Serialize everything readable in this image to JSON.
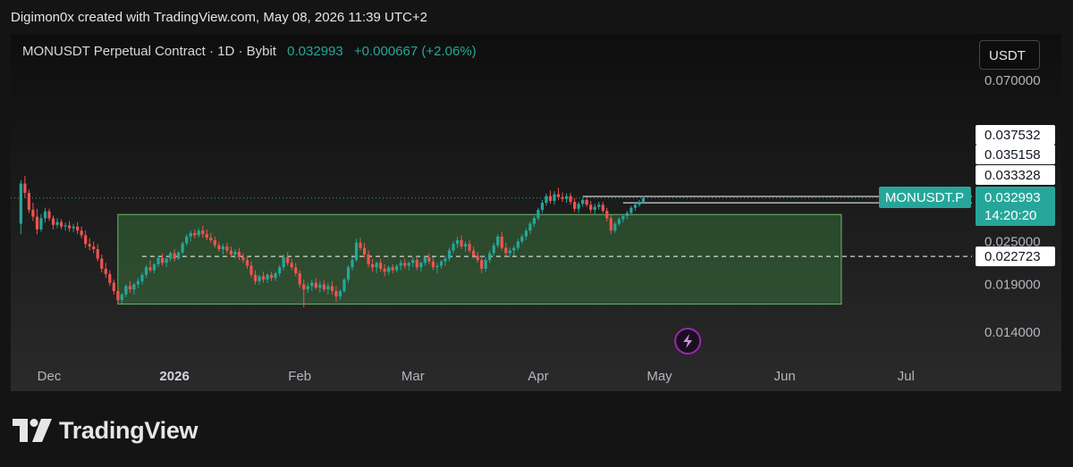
{
  "header": {
    "text": "Digimon0x created with TradingView.com, May 08, 2026 11:39 UTC+2"
  },
  "legend": {
    "title": "MONUSDT Perpetual Contract · 1D · Bybit",
    "price": "0.032993",
    "change": "+0.000667 (+2.06%)"
  },
  "currency_button": "USDT",
  "footer": {
    "brand": "TradingView"
  },
  "colors": {
    "up": "#26a69a",
    "down": "#ef5350",
    "box_fill": "rgba(76,175,80,0.30)",
    "box_stroke": "#66bb6a",
    "line": "#ffffff",
    "accent_icon": "#9c27b0"
  },
  "icons": {
    "logo": "tradingview-logo-icon",
    "lightning": "lightning-icon"
  },
  "chart_data": {
    "type": "candlestick",
    "title": "MONUSDT Perpetual Contract · 1D · Bybit",
    "x_axis_labels": [
      {
        "label": "Dec",
        "date": "2025-12-01",
        "bold": false
      },
      {
        "label": "2026",
        "date": "2026-01-01",
        "bold": true
      },
      {
        "label": "Feb",
        "date": "2026-02-01",
        "bold": false
      },
      {
        "label": "Mar",
        "date": "2026-03-01",
        "bold": false
      },
      {
        "label": "Apr",
        "date": "2026-04-01",
        "bold": false
      },
      {
        "label": "May",
        "date": "2026-05-01",
        "bold": false
      },
      {
        "label": "Jun",
        "date": "2026-06-01",
        "bold": false
      },
      {
        "label": "Jul",
        "date": "2026-07-01",
        "bold": false
      }
    ],
    "y_axis_labels": [
      "0.070000",
      "0.025000",
      "0.019000",
      "0.014000"
    ],
    "y_axis_values": [
      0.07,
      0.025,
      0.019,
      0.014
    ],
    "scale": "log",
    "current_price": {
      "symbol_label": "MONUSDT.P",
      "value": "0.032993",
      "countdown": "14:20:20"
    },
    "level_labels": [
      {
        "value": "0.037532",
        "style": "none"
      },
      {
        "value": "0.035158",
        "style": "none"
      },
      {
        "value": "0.033328",
        "style": "solid",
        "start_date": "2026-04-12"
      },
      {
        "value": "0.022723",
        "style": "dashed",
        "start_date": "2025-12-24"
      }
    ],
    "extra_line": {
      "value": 0.032,
      "start_date": "2026-04-22"
    },
    "range_box": {
      "start_date": "2025-12-18",
      "end_date": "2026-06-15",
      "top": 0.0297,
      "bottom": 0.01675
    },
    "lightning_marker_date": "2026-05-08",
    "ohlc_daily_from": "2025-11-24",
    "ohlc": [
      [
        0.028,
        0.037,
        0.0262,
        0.0362
      ],
      [
        0.0362,
        0.038,
        0.033,
        0.0341
      ],
      [
        0.0341,
        0.0348,
        0.03,
        0.0306
      ],
      [
        0.0306,
        0.032,
        0.0285,
        0.0293
      ],
      [
        0.0293,
        0.0308,
        0.0262,
        0.027
      ],
      [
        0.027,
        0.0298,
        0.0266,
        0.029
      ],
      [
        0.029,
        0.031,
        0.0282,
        0.0303
      ],
      [
        0.0303,
        0.0308,
        0.0285,
        0.029
      ],
      [
        0.029,
        0.0295,
        0.027,
        0.0278
      ],
      [
        0.0278,
        0.029,
        0.0272,
        0.0283
      ],
      [
        0.0283,
        0.0288,
        0.027,
        0.0275
      ],
      [
        0.0275,
        0.0282,
        0.0268,
        0.0277
      ],
      [
        0.0277,
        0.0285,
        0.0266,
        0.0272
      ],
      [
        0.0272,
        0.028,
        0.0265,
        0.0275
      ],
      [
        0.0275,
        0.0283,
        0.0262,
        0.0268
      ],
      [
        0.0268,
        0.0275,
        0.0255,
        0.026
      ],
      [
        0.026,
        0.0268,
        0.024,
        0.0246
      ],
      [
        0.0246,
        0.0255,
        0.0236,
        0.0242
      ],
      [
        0.0242,
        0.025,
        0.0232,
        0.0238
      ],
      [
        0.0238,
        0.0246,
        0.022,
        0.0224
      ],
      [
        0.0224,
        0.023,
        0.0205,
        0.021
      ],
      [
        0.021,
        0.0218,
        0.0198,
        0.0203
      ],
      [
        0.0203,
        0.0208,
        0.0188,
        0.0192
      ],
      [
        0.0192,
        0.0196,
        0.0178,
        0.0182
      ],
      [
        0.0182,
        0.0186,
        0.01675,
        0.0172
      ],
      [
        0.0172,
        0.018,
        0.0168,
        0.0178
      ],
      [
        0.0178,
        0.019,
        0.0175,
        0.0188
      ],
      [
        0.0188,
        0.0194,
        0.018,
        0.0184
      ],
      [
        0.0184,
        0.0192,
        0.0178,
        0.019
      ],
      [
        0.019,
        0.0198,
        0.0185,
        0.0194
      ],
      [
        0.0194,
        0.0205,
        0.019,
        0.0202
      ],
      [
        0.0202,
        0.0215,
        0.0198,
        0.0212
      ],
      [
        0.0212,
        0.0222,
        0.0205,
        0.0208
      ],
      [
        0.0208,
        0.0218,
        0.0204,
        0.0216
      ],
      [
        0.0216,
        0.0228,
        0.0212,
        0.0225
      ],
      [
        0.0225,
        0.0232,
        0.0214,
        0.0218
      ],
      [
        0.0218,
        0.0226,
        0.0212,
        0.0224
      ],
      [
        0.0224,
        0.0235,
        0.022,
        0.0232
      ],
      [
        0.0232,
        0.0238,
        0.022,
        0.0224
      ],
      [
        0.0224,
        0.0235,
        0.0222,
        0.0233
      ],
      [
        0.0233,
        0.025,
        0.023,
        0.0247
      ],
      [
        0.0247,
        0.0262,
        0.0243,
        0.0258
      ],
      [
        0.0258,
        0.0268,
        0.025,
        0.0264
      ],
      [
        0.0264,
        0.027,
        0.0255,
        0.026
      ],
      [
        0.026,
        0.0272,
        0.0256,
        0.0268
      ],
      [
        0.0268,
        0.0276,
        0.0256,
        0.0262
      ],
      [
        0.0262,
        0.027,
        0.0252,
        0.0256
      ],
      [
        0.0256,
        0.0264,
        0.0248,
        0.0252
      ],
      [
        0.0252,
        0.0258,
        0.024,
        0.0244
      ],
      [
        0.0244,
        0.025,
        0.0234,
        0.0238
      ],
      [
        0.0238,
        0.0246,
        0.023,
        0.0242
      ],
      [
        0.0242,
        0.0248,
        0.0232,
        0.0236
      ],
      [
        0.0236,
        0.0242,
        0.0226,
        0.023
      ],
      [
        0.023,
        0.0238,
        0.0224,
        0.0234
      ],
      [
        0.0234,
        0.024,
        0.0222,
        0.0226
      ],
      [
        0.0226,
        0.0232,
        0.0218,
        0.0222
      ],
      [
        0.0222,
        0.0228,
        0.021,
        0.0214
      ],
      [
        0.0214,
        0.022,
        0.0198,
        0.0202
      ],
      [
        0.0202,
        0.0208,
        0.019,
        0.0194
      ],
      [
        0.0194,
        0.0202,
        0.019,
        0.02
      ],
      [
        0.02,
        0.0206,
        0.0192,
        0.0196
      ],
      [
        0.0196,
        0.0204,
        0.0192,
        0.0202
      ],
      [
        0.0202,
        0.0206,
        0.0194,
        0.0198
      ],
      [
        0.0198,
        0.0206,
        0.0194,
        0.0204
      ],
      [
        0.0204,
        0.0215,
        0.02,
        0.0212
      ],
      [
        0.0212,
        0.023,
        0.0208,
        0.0226
      ],
      [
        0.0226,
        0.0234,
        0.0214,
        0.0218
      ],
      [
        0.0218,
        0.0224,
        0.0208,
        0.0212
      ],
      [
        0.0212,
        0.0218,
        0.02,
        0.0204
      ],
      [
        0.0204,
        0.0208,
        0.0186,
        0.019
      ],
      [
        0.019,
        0.0196,
        0.0164,
        0.0184
      ],
      [
        0.0184,
        0.0192,
        0.018,
        0.0188
      ],
      [
        0.0188,
        0.0196,
        0.0182,
        0.0192
      ],
      [
        0.0192,
        0.0198,
        0.0184,
        0.0186
      ],
      [
        0.0186,
        0.0194,
        0.018,
        0.019
      ],
      [
        0.019,
        0.0195,
        0.0181,
        0.0184
      ],
      [
        0.0184,
        0.0192,
        0.0178,
        0.0188
      ],
      [
        0.0188,
        0.0194,
        0.0178,
        0.0182
      ],
      [
        0.0182,
        0.0188,
        0.017,
        0.0176
      ],
      [
        0.0176,
        0.0184,
        0.0172,
        0.0182
      ],
      [
        0.0182,
        0.0198,
        0.018,
        0.0196
      ],
      [
        0.0196,
        0.0215,
        0.0192,
        0.0212
      ],
      [
        0.0212,
        0.0226,
        0.0208,
        0.0222
      ],
      [
        0.0222,
        0.0254,
        0.022,
        0.0248
      ],
      [
        0.0248,
        0.0256,
        0.0236,
        0.024
      ],
      [
        0.024,
        0.0248,
        0.0226,
        0.023
      ],
      [
        0.023,
        0.0236,
        0.0212,
        0.0216
      ],
      [
        0.0216,
        0.0224,
        0.0206,
        0.0212
      ],
      [
        0.0212,
        0.022,
        0.0204,
        0.0218
      ],
      [
        0.0218,
        0.0224,
        0.0206,
        0.021
      ],
      [
        0.021,
        0.0216,
        0.02,
        0.0206
      ],
      [
        0.0206,
        0.0214,
        0.0202,
        0.0212
      ],
      [
        0.0212,
        0.0216,
        0.0204,
        0.0208
      ],
      [
        0.0208,
        0.0216,
        0.0205,
        0.0214
      ],
      [
        0.0214,
        0.0222,
        0.0208,
        0.0218
      ],
      [
        0.0218,
        0.0224,
        0.021,
        0.0214
      ],
      [
        0.0214,
        0.022,
        0.0208,
        0.0218
      ],
      [
        0.0218,
        0.0226,
        0.0212,
        0.0222
      ],
      [
        0.0222,
        0.0228,
        0.0208,
        0.0212
      ],
      [
        0.0212,
        0.022,
        0.0206,
        0.0218
      ],
      [
        0.0218,
        0.0228,
        0.0214,
        0.0226
      ],
      [
        0.0226,
        0.0232,
        0.0216,
        0.022
      ],
      [
        0.022,
        0.0226,
        0.0208,
        0.0212
      ],
      [
        0.0212,
        0.0218,
        0.0204,
        0.0214
      ],
      [
        0.0214,
        0.0222,
        0.021,
        0.022
      ],
      [
        0.022,
        0.0228,
        0.0214,
        0.0224
      ],
      [
        0.0224,
        0.024,
        0.022,
        0.0236
      ],
      [
        0.0236,
        0.025,
        0.0232,
        0.0246
      ],
      [
        0.0246,
        0.0258,
        0.024,
        0.0252
      ],
      [
        0.0252,
        0.026,
        0.0238,
        0.0242
      ],
      [
        0.0242,
        0.025,
        0.0234,
        0.0246
      ],
      [
        0.0246,
        0.0252,
        0.0232,
        0.0236
      ],
      [
        0.0236,
        0.0242,
        0.0224,
        0.0228
      ],
      [
        0.0228,
        0.0234,
        0.0218,
        0.0222
      ],
      [
        0.0222,
        0.0228,
        0.0204,
        0.021
      ],
      [
        0.021,
        0.0226,
        0.0206,
        0.0222
      ],
      [
        0.0222,
        0.0236,
        0.0218,
        0.0232
      ],
      [
        0.0232,
        0.0248,
        0.0228,
        0.0244
      ],
      [
        0.0244,
        0.0262,
        0.024,
        0.0258
      ],
      [
        0.0258,
        0.0266,
        0.0236,
        0.024
      ],
      [
        0.024,
        0.0248,
        0.0226,
        0.0232
      ],
      [
        0.0232,
        0.024,
        0.0226,
        0.0236
      ],
      [
        0.0236,
        0.0244,
        0.0228,
        0.024
      ],
      [
        0.024,
        0.0254,
        0.0236,
        0.025
      ],
      [
        0.025,
        0.0262,
        0.0246,
        0.0258
      ],
      [
        0.0258,
        0.0272,
        0.0252,
        0.0268
      ],
      [
        0.0268,
        0.0284,
        0.0262,
        0.028
      ],
      [
        0.028,
        0.0294,
        0.0274,
        0.029
      ],
      [
        0.029,
        0.031,
        0.0286,
        0.0306
      ],
      [
        0.0306,
        0.0326,
        0.03,
        0.032
      ],
      [
        0.032,
        0.034,
        0.0314,
        0.0334
      ],
      [
        0.0334,
        0.0346,
        0.0318,
        0.0324
      ],
      [
        0.0324,
        0.0345,
        0.0316,
        0.0338
      ],
      [
        0.0338,
        0.0352,
        0.0326,
        0.0332
      ],
      [
        0.0332,
        0.0342,
        0.0322,
        0.0328
      ],
      [
        0.0328,
        0.034,
        0.032,
        0.0334
      ],
      [
        0.0334,
        0.0341,
        0.0316,
        0.0322
      ],
      [
        0.0322,
        0.033,
        0.0302,
        0.0308
      ],
      [
        0.0308,
        0.0322,
        0.03,
        0.0318
      ],
      [
        0.0318,
        0.033,
        0.0312,
        0.0326
      ],
      [
        0.0326,
        0.0332,
        0.0312,
        0.0316
      ],
      [
        0.0316,
        0.0324,
        0.03,
        0.0306
      ],
      [
        0.0306,
        0.0318,
        0.0298,
        0.0312
      ],
      [
        0.0312,
        0.0322,
        0.0306,
        0.0316
      ],
      [
        0.0316,
        0.0322,
        0.03,
        0.0304
      ],
      [
        0.0304,
        0.031,
        0.0284,
        0.029
      ],
      [
        0.029,
        0.0296,
        0.0262,
        0.0268
      ],
      [
        0.0268,
        0.0284,
        0.0264,
        0.028
      ],
      [
        0.028,
        0.0292,
        0.0276,
        0.0288
      ],
      [
        0.0288,
        0.0298,
        0.0282,
        0.0294
      ],
      [
        0.0294,
        0.0304,
        0.0288,
        0.03
      ],
      [
        0.03,
        0.0314,
        0.0296,
        0.031
      ],
      [
        0.031,
        0.032,
        0.0304,
        0.0316
      ],
      [
        0.0316,
        0.0326,
        0.0312,
        0.0322
      ],
      [
        0.0322,
        0.0334,
        0.0318,
        0.033
      ]
    ]
  }
}
